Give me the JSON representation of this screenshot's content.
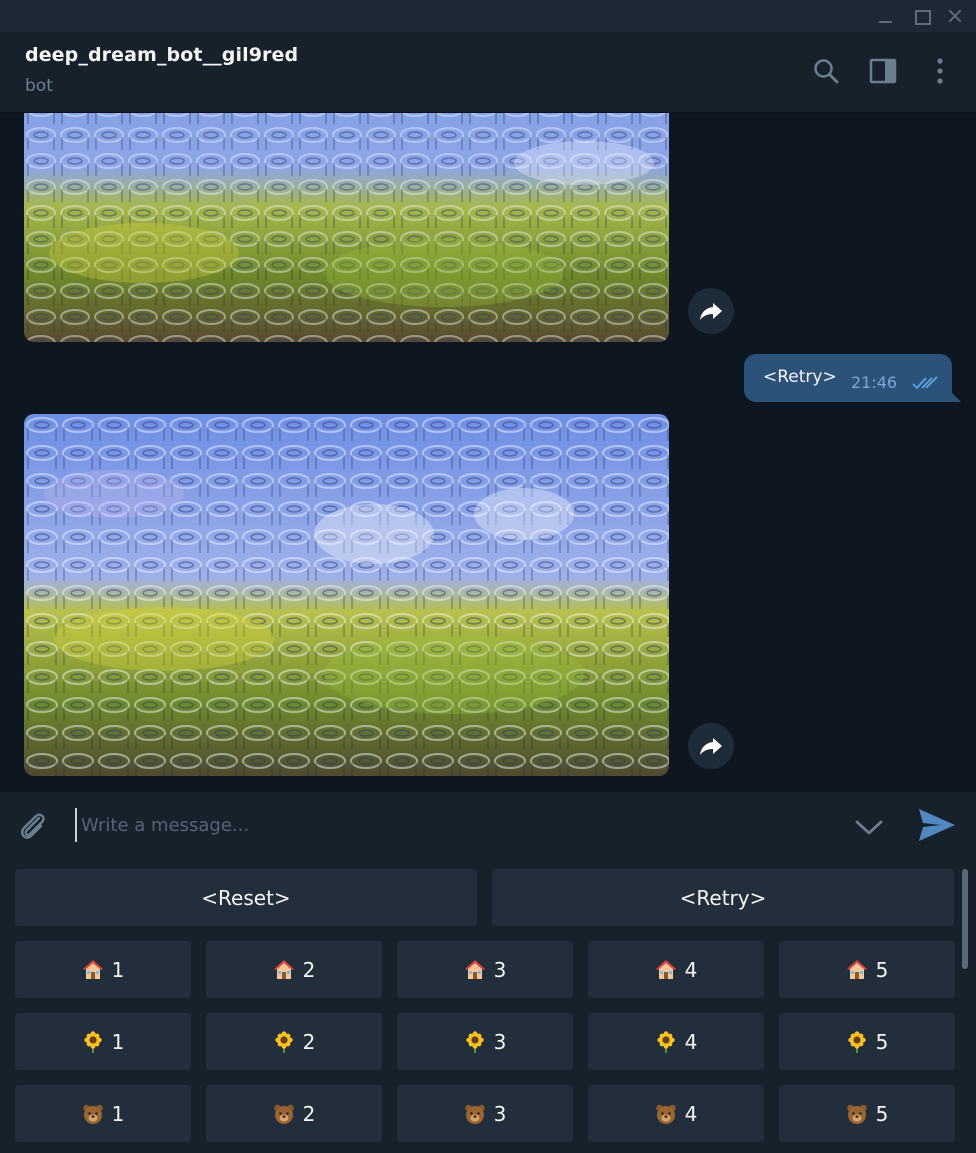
{
  "chat": {
    "title": "deep_dream_bot__gil9red",
    "status": "bot"
  },
  "messages": {
    "retry_bubble": {
      "text": "<Retry>",
      "time": "21:46"
    }
  },
  "composer": {
    "placeholder": "Write a message..."
  },
  "keyboard": {
    "wide": [
      {
        "label": "<Reset>"
      },
      {
        "label": "<Retry>"
      }
    ],
    "rows": [
      {
        "emoji": "house-icon",
        "keys": [
          "1",
          "2",
          "3",
          "4",
          "5"
        ]
      },
      {
        "emoji": "sunflower-icon",
        "keys": [
          "1",
          "2",
          "3",
          "4",
          "5"
        ]
      },
      {
        "emoji": "bear-icon",
        "keys": [
          "1",
          "2",
          "3",
          "4",
          "5"
        ]
      }
    ]
  },
  "colors": {
    "background": "#0e1621",
    "panel": "#17212b",
    "bubble_out": "#2b5278",
    "key_button": "#232e3c",
    "accent": "#5288c1"
  }
}
